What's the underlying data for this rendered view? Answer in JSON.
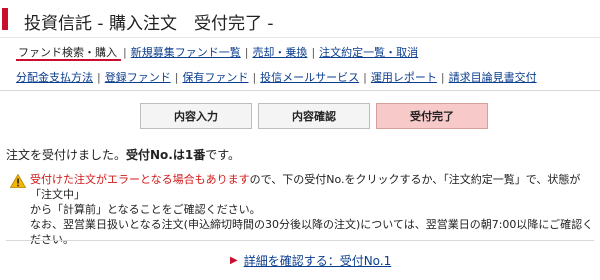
{
  "page": {
    "title": "投資信託 - 購入注文　受付完了 -"
  },
  "nav_primary": {
    "items": [
      "ファンド検索・購入",
      "新規募集ファンド一覧",
      "売却・乗換",
      "注文約定一覧・取消"
    ],
    "separator": "|"
  },
  "nav_secondary": {
    "items": [
      "分配金支払方法",
      "登録ファンド",
      "保有ファンド",
      "投信メールサービス",
      "運用レポート",
      "請求目論見書交付"
    ],
    "separator": "|"
  },
  "steps": {
    "items": [
      "内容入力",
      "内容確認",
      "受付完了"
    ],
    "current_index": 2
  },
  "message": {
    "prefix": "注文を受付けました。",
    "bold": "受付No.は1番",
    "suffix": "です。"
  },
  "warning": {
    "icon": "warning-icon",
    "red_text": "受付けた注文がエラーとなる場合もあります",
    "line1_rest": "ので、下の受付No.をクリックするか、「注文約定一覧」で、状態が「注文中」",
    "line2": "から「計算前」となることをご確認ください。",
    "line3": "なお、翌営業日扱いとなる注文(申込締切時間の30分後以降の注文)については、翌営業日の朝7:00以降にご確認ください。"
  },
  "detail_link": {
    "label": "詳細を確認する：受付No.1",
    "arrow_icon": "triangle-right-icon"
  },
  "colors": {
    "accent": "#c8102e",
    "link": "#0b3e8f",
    "current_step_bg": "#f7c9c9",
    "warning_red": "#d11a1a"
  }
}
